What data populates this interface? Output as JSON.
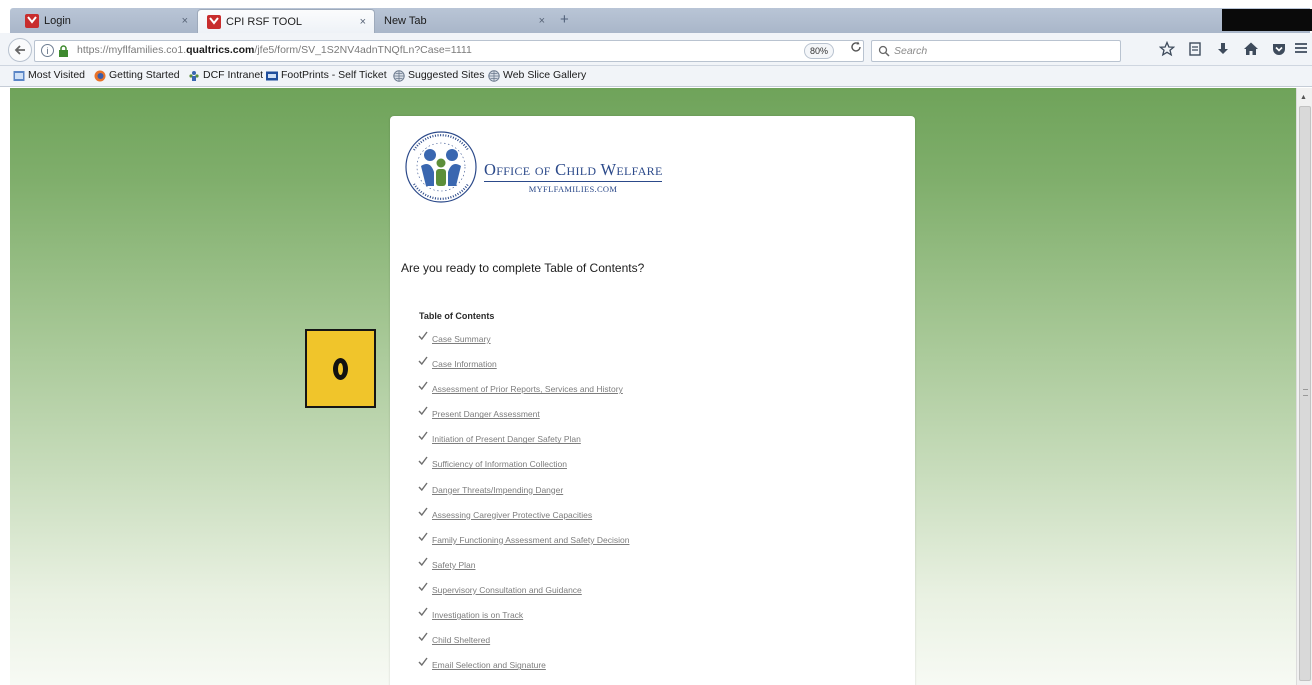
{
  "browser": {
    "tabs": [
      {
        "title": "Login",
        "active": false
      },
      {
        "title": "CPI RSF TOOL",
        "active": true
      },
      {
        "title": "New Tab",
        "active": false
      }
    ],
    "tab_close_glyph": "×",
    "new_tab_glyph": "+",
    "url": {
      "prefix": "https://myflfamilies.co1.",
      "domain": "qualtrics.com",
      "path": "/jfe5/form/SV_1S2NV4adnTNQfLn?Case=1111"
    },
    "zoom": "80%",
    "search_placeholder": "Search",
    "bookmarks": [
      {
        "label": "Most Visited",
        "icon": "bookmarks-folder-icon"
      },
      {
        "label": "Getting Started",
        "icon": "firefox-icon"
      },
      {
        "label": "DCF Intranet",
        "icon": "dcf-icon"
      },
      {
        "label": "FootPrints - Self Ticket",
        "icon": "footprints-icon"
      },
      {
        "label": "Suggested Sites",
        "icon": "globe-icon"
      },
      {
        "label": "Web Slice Gallery",
        "icon": "globe-icon"
      }
    ],
    "toolbar_icons": [
      "star-icon",
      "reading-list-icon",
      "download-icon",
      "home-icon",
      "pocket-icon",
      "menu-icon"
    ],
    "colors": {
      "tab_strip": "#b9c5d6",
      "nav_bg": "#f1f4f8"
    }
  },
  "page": {
    "logo": {
      "title": "Office of Child Welfare",
      "subtitle": "MYFLFAMILIES.COM",
      "seal_text": "FLORIDA DEPARTMENT OF CHILDREN AND FAMILIES",
      "colors": {
        "brand_blue": "#2c4a8a",
        "seal_green": "#5d8f3a",
        "seal_blue": "#3a67b0"
      }
    },
    "question": "Are you ready to complete Table of Contents?",
    "toc": {
      "heading": "Table of Contents",
      "items": [
        "Case Summary",
        "Case Information",
        "Assessment of Prior Reports, Services and History",
        "Present Danger Assessment",
        "Initiation of Present Danger Safety Plan",
        "Sufficiency of Information Collection",
        "Danger Threats/Impending Danger",
        "Assessing Caregiver Protective Capacities",
        "Family Functioning Assessment and Safety Decision",
        "Safety Plan",
        "Supervisory Consultation and Guidance",
        "Investigation is on Track",
        "Child Sheltered",
        "Email Selection and Signature"
      ]
    },
    "background_gradient": [
      "#6fa35a",
      "#f7faf4"
    ]
  },
  "annotation": {
    "glyph": "0",
    "colors": {
      "fill": "#f0c52b",
      "border": "#151515"
    }
  }
}
